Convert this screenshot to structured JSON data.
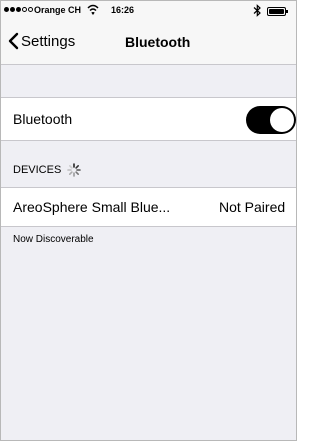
{
  "status_bar": {
    "carrier": "Orange CH",
    "time": "16:26",
    "icons": [
      "signal-dots",
      "wifi-icon",
      "bluetooth-icon",
      "battery-icon"
    ]
  },
  "nav": {
    "back_label": "Settings",
    "title": "Bluetooth"
  },
  "bluetooth_row": {
    "label": "Bluetooth",
    "toggle_on": true
  },
  "devices": {
    "header": "DEVICES",
    "items": [
      {
        "name": "AreoSphere Small Blue...",
        "status": "Not Paired"
      }
    ]
  },
  "footer": {
    "discoverable_text": "Now Discoverable"
  },
  "colors": {
    "background": "#efeff4",
    "bar": "#f7f7f7",
    "toggle_on": "#000000"
  }
}
